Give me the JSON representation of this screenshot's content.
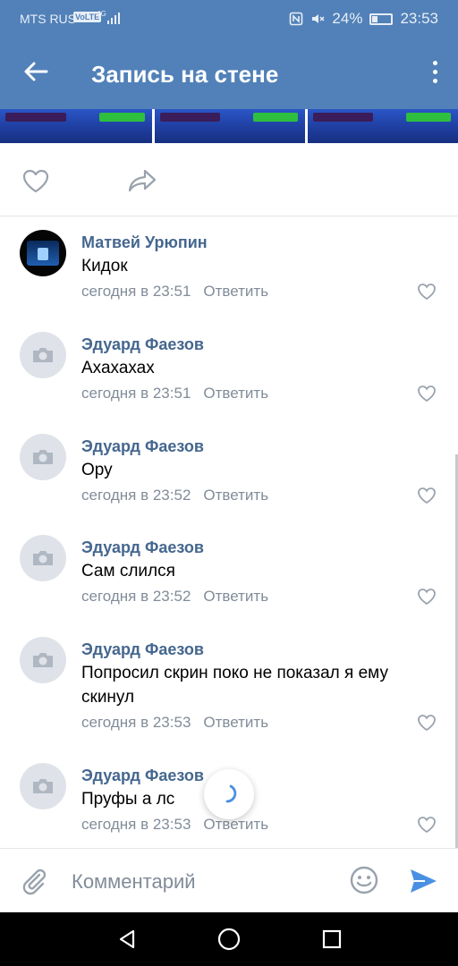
{
  "status": {
    "carrier": "MTS RUS",
    "volte": "VoLTE",
    "network": "4G",
    "battery": "24%",
    "time": "23:53"
  },
  "appbar": {
    "title": "Запись на стене"
  },
  "comments": [
    {
      "author": "Матвей Урюпин",
      "text": "Кидок",
      "time": "сегодня в 23:51",
      "reply": "Ответить",
      "avatar": "photo"
    },
    {
      "author": "Эдуард Фаезов",
      "text": "Ахахахах",
      "time": "сегодня в 23:51",
      "reply": "Ответить",
      "avatar": "camera-icon"
    },
    {
      "author": "Эдуард Фаезов",
      "text": "Ору",
      "time": "сегодня в 23:52",
      "reply": "Ответить",
      "avatar": "camera-icon"
    },
    {
      "author": "Эдуард Фаезов",
      "text": "Сам слился",
      "time": "сегодня в 23:52",
      "reply": "Ответить",
      "avatar": "camera-icon"
    },
    {
      "author": "Эдуард Фаезов",
      "text": "Попросил скрин поко не показал я ему скинул",
      "time": "сегодня в 23:53",
      "reply": "Ответить",
      "avatar": "camera-icon"
    },
    {
      "author": "Эдуард Фаезов",
      "text": "Пруфы а лс",
      "time": "сегодня в 23:53",
      "reply": "Ответить",
      "avatar": "camera-icon"
    }
  ],
  "composer": {
    "placeholder": "Комментарий",
    "value": ""
  },
  "colors": {
    "brand": "#5181b8",
    "author": "#45678f",
    "meta": "#818c99",
    "send": "#4a90e2"
  }
}
